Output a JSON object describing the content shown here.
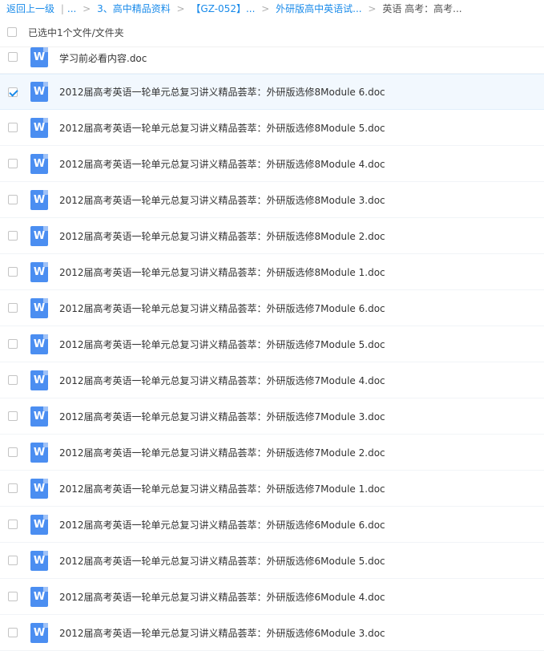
{
  "breadcrumb": {
    "back": "返回上一级",
    "sep_bar": "|",
    "ellipsis": "...",
    "sep": ">",
    "level1": "3、高中精品资料",
    "level2": "【GZ-052】...",
    "level3": "外研版高中英语试...",
    "current": "英语 高考：高考..."
  },
  "selection": {
    "label": "已选中1个文件/文件夹"
  },
  "icon": {
    "name": "word-doc-icon",
    "glyph": "W",
    "color": "#4b8ef1"
  },
  "colors": {
    "accent": "#1a8bea",
    "selected_row": "#f2f8fe"
  },
  "files": [
    {
      "name": "学习前必看内容.doc",
      "checked": false
    },
    {
      "name": "2012届高考英语一轮单元总复习讲义精品荟萃：外研版选修8Module 6.doc",
      "checked": true
    },
    {
      "name": "2012届高考英语一轮单元总复习讲义精品荟萃：外研版选修8Module 5.doc",
      "checked": false
    },
    {
      "name": "2012届高考英语一轮单元总复习讲义精品荟萃：外研版选修8Module 4.doc",
      "checked": false
    },
    {
      "name": "2012届高考英语一轮单元总复习讲义精品荟萃：外研版选修8Module 3.doc",
      "checked": false
    },
    {
      "name": "2012届高考英语一轮单元总复习讲义精品荟萃：外研版选修8Module 2.doc",
      "checked": false
    },
    {
      "name": "2012届高考英语一轮单元总复习讲义精品荟萃：外研版选修8Module 1.doc",
      "checked": false
    },
    {
      "name": "2012届高考英语一轮单元总复习讲义精品荟萃：外研版选修7Module 6.doc",
      "checked": false
    },
    {
      "name": "2012届高考英语一轮单元总复习讲义精品荟萃：外研版选修7Module 5.doc",
      "checked": false
    },
    {
      "name": "2012届高考英语一轮单元总复习讲义精品荟萃：外研版选修7Module 4.doc",
      "checked": false
    },
    {
      "name": "2012届高考英语一轮单元总复习讲义精品荟萃：外研版选修7Module 3.doc",
      "checked": false
    },
    {
      "name": "2012届高考英语一轮单元总复习讲义精品荟萃：外研版选修7Module 2.doc",
      "checked": false
    },
    {
      "name": "2012届高考英语一轮单元总复习讲义精品荟萃：外研版选修7Module 1.doc",
      "checked": false
    },
    {
      "name": "2012届高考英语一轮单元总复习讲义精品荟萃：外研版选修6Module 6.doc",
      "checked": false
    },
    {
      "name": "2012届高考英语一轮单元总复习讲义精品荟萃：外研版选修6Module 5.doc",
      "checked": false
    },
    {
      "name": "2012届高考英语一轮单元总复习讲义精品荟萃：外研版选修6Module 4.doc",
      "checked": false
    },
    {
      "name": "2012届高考英语一轮单元总复习讲义精品荟萃：外研版选修6Module 3.doc",
      "checked": false
    }
  ]
}
